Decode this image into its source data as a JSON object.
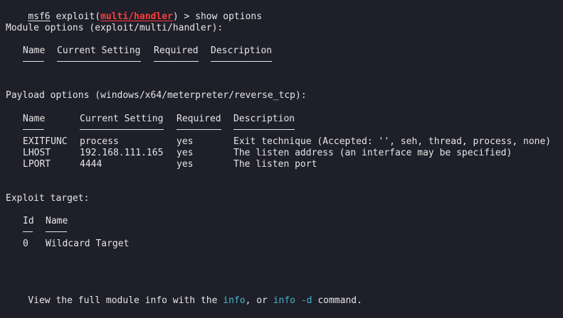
{
  "prompt": {
    "user": "msf6",
    "pre": " exploit(",
    "module": "multi/handler",
    "post": ") > ",
    "command": "show options"
  },
  "module_options": {
    "heading": "Module options (exploit/multi/handler):",
    "columns": [
      "Name",
      "Current Setting",
      "Required",
      "Description"
    ]
  },
  "payload_options": {
    "heading": "Payload options (windows/x64/meterpreter/reverse_tcp):",
    "columns": [
      "Name",
      "Current Setting",
      "Required",
      "Description"
    ],
    "rows": [
      {
        "name": "EXITFUNC",
        "setting": "process",
        "required": "yes",
        "description": "Exit technique (Accepted: '', seh, thread, process, none)"
      },
      {
        "name": "LHOST",
        "setting": "192.168.111.165",
        "required": "yes",
        "description": "The listen address (an interface may be specified)"
      },
      {
        "name": "LPORT",
        "setting": "4444",
        "required": "yes",
        "description": "The listen port"
      }
    ]
  },
  "exploit_target": {
    "heading": "Exploit target:",
    "columns": [
      "Id",
      "Name"
    ],
    "rows": [
      {
        "id": "0",
        "name": "Wildcard Target"
      }
    ]
  },
  "footer": {
    "pre": "View the full module info with the ",
    "info": "info",
    "mid": ", or ",
    "info_d": "info -d",
    "post": " command."
  },
  "colors": {
    "background": "#1e1f29",
    "text": "#e6e6e6",
    "module_red": "#ff3b3b",
    "command_cyan": "#44b6c9"
  }
}
